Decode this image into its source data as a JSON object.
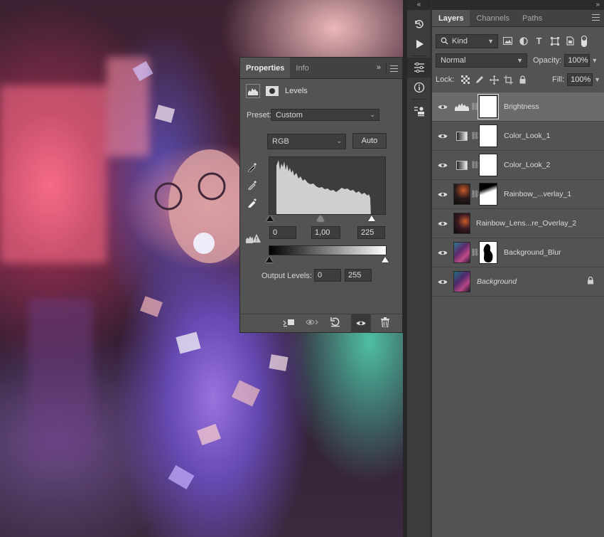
{
  "dock": {
    "collapse": "«",
    "icons": [
      "history-icon",
      "play-icon",
      "adjustments-icon",
      "info-icon",
      "libraries-icon"
    ]
  },
  "layers_panel": {
    "collapse": "»",
    "tabs": [
      "Layers",
      "Channels",
      "Paths"
    ],
    "filter": {
      "kind": "Kind"
    },
    "blend_mode": "Normal",
    "opacity_label": "Opacity:",
    "opacity_value": "100%",
    "lock_label": "Lock:",
    "fill_label": "Fill:",
    "fill_value": "100%",
    "layers": [
      {
        "name": "Brightness",
        "type": "levels",
        "selected": true
      },
      {
        "name": "Color_Look_1",
        "type": "gradient"
      },
      {
        "name": "Color_Look_2",
        "type": "gradient"
      },
      {
        "name": "Rainbow_...verlay_1",
        "type": "smart",
        "mask": "partial"
      },
      {
        "name": "Rainbow_Lens...re_Overlay_2",
        "type": "smart"
      },
      {
        "name": "Background_Blur",
        "type": "smart",
        "mask": "figure"
      },
      {
        "name": "Background",
        "type": "image",
        "italic": true,
        "locked": true
      }
    ]
  },
  "properties": {
    "tabs": [
      "Properties",
      "Info"
    ],
    "menu": "»",
    "adjustment": "Levels",
    "preset_label": "Preset:",
    "preset_value": "Custom",
    "channel": "RGB",
    "auto_label": "Auto",
    "input_levels": [
      "0",
      "1,00",
      "225"
    ],
    "output_label": "Output Levels:",
    "output_levels": [
      "0",
      "255"
    ]
  }
}
